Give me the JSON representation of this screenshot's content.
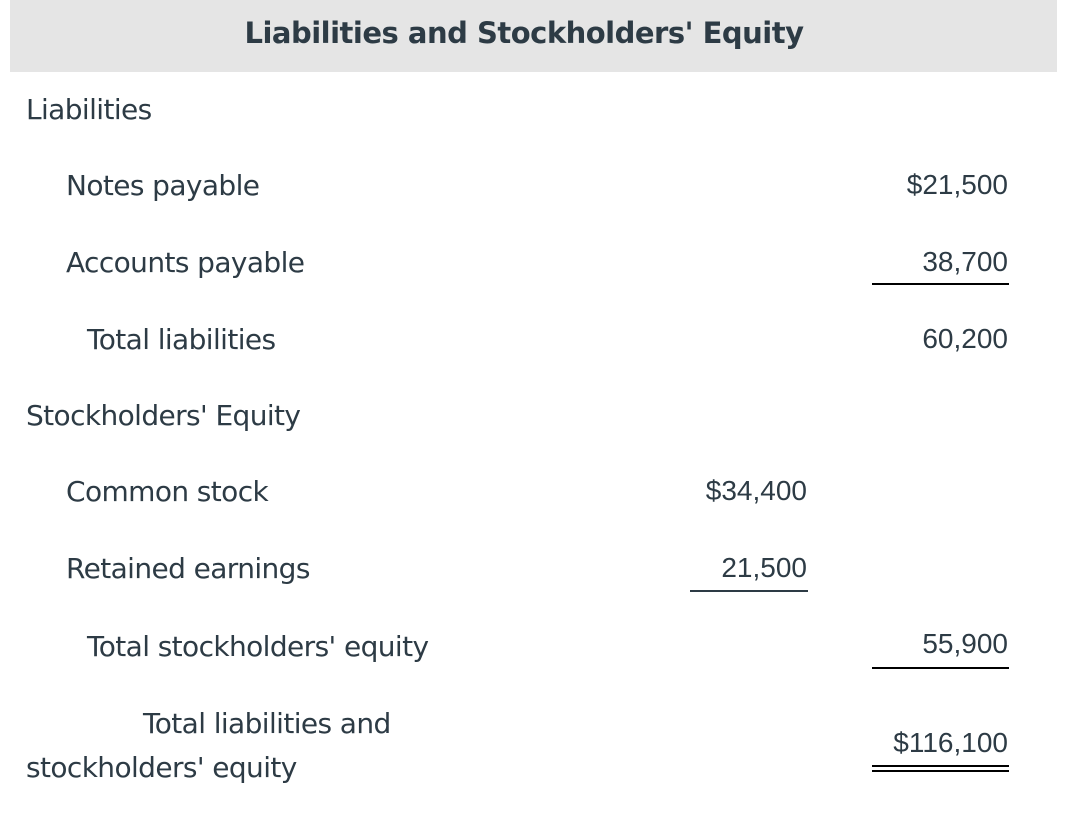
{
  "header": {
    "title": "Liabilities and Stockholders' Equity"
  },
  "sections": {
    "liabilities": {
      "heading": "Liabilities",
      "items": [
        {
          "label": "Notes payable",
          "amount": "$21,500"
        },
        {
          "label": "Accounts payable",
          "amount": "38,700"
        }
      ],
      "total": {
        "label": "Total liabilities",
        "amount": "60,200"
      }
    },
    "equity": {
      "heading": "Stockholders' Equity",
      "items": [
        {
          "label": "Common stock",
          "amount": "$34,400"
        },
        {
          "label": "Retained earnings",
          "amount": "21,500"
        }
      ],
      "total": {
        "label": "Total stockholders' equity",
        "amount": "55,900"
      }
    },
    "grand_total": {
      "label_line1": "Total liabilities and",
      "label_line2": "stockholders' equity",
      "amount": "$116,100"
    }
  }
}
